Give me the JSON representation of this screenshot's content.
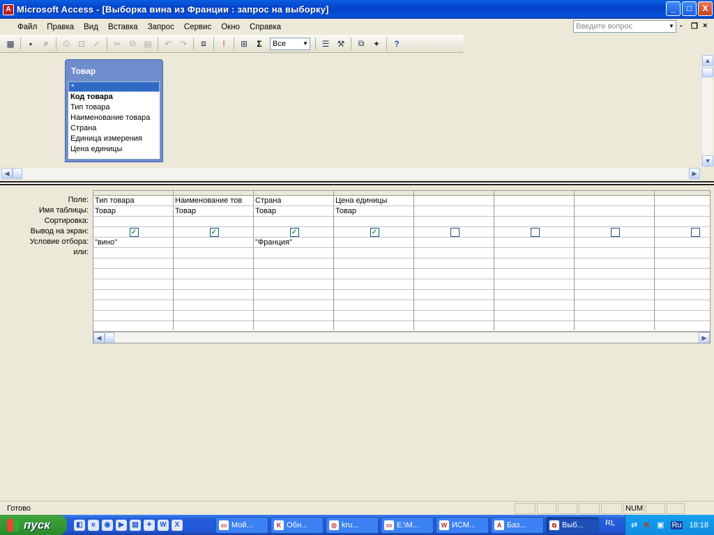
{
  "window": {
    "title": "Microsoft Access - [Выборка вина из Франции : запрос на выборку]",
    "min": "_",
    "max": "□",
    "close": "X"
  },
  "menu": {
    "items": [
      "Файл",
      "Правка",
      "Вид",
      "Вставка",
      "Запрос",
      "Сервис",
      "Окно",
      "Справка"
    ],
    "ask_placeholder": "Введите вопрос"
  },
  "toolbar": {
    "top_values": "Все",
    "sigma": "Σ",
    "exclaim": "!",
    "help": "?"
  },
  "table": {
    "name": "Товар",
    "fields": [
      "*",
      "Код товара",
      "Тип товара",
      "Наименование товара",
      "Страна",
      "Единица измерения",
      "Цена единицы"
    ]
  },
  "grid": {
    "row_labels": [
      "Поле:",
      "Имя таблицы:",
      "Сортировка:",
      "Вывод на экран:",
      "Условие отбора:",
      "или:"
    ],
    "columns": [
      {
        "field": "Тип товара",
        "table": "Товар",
        "sort": "",
        "show": true,
        "criteria": "\"вино\""
      },
      {
        "field": "Наименование тов",
        "table": "Товар",
        "sort": "",
        "show": true,
        "criteria": ""
      },
      {
        "field": "Страна",
        "table": "Товар",
        "sort": "",
        "show": true,
        "criteria": "\"Франция\""
      },
      {
        "field": "Цена единицы",
        "table": "Товар",
        "sort": "",
        "show": true,
        "criteria": ""
      },
      {
        "field": "",
        "table": "",
        "sort": "",
        "show": false,
        "criteria": ""
      },
      {
        "field": "",
        "table": "",
        "sort": "",
        "show": false,
        "criteria": ""
      },
      {
        "field": "",
        "table": "",
        "sort": "",
        "show": false,
        "criteria": ""
      },
      {
        "field": "",
        "table": "",
        "sort": "",
        "show": false,
        "criteria": ""
      }
    ]
  },
  "status": {
    "text": "Готово",
    "num": "NUM"
  },
  "taskbar": {
    "start": "пуск",
    "tasks": [
      "Мой...",
      "Обн...",
      "kru...",
      "E:\\M...",
      "ИСМ...",
      "Баз...",
      "Выб..."
    ],
    "lang": "RL",
    "tray_lang": "Ru",
    "clock": "18:18"
  }
}
